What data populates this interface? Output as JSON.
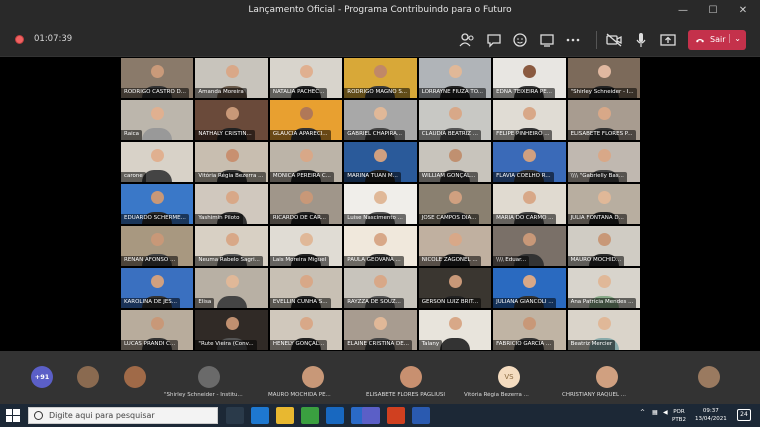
{
  "window": {
    "title": "Lançamento Oficial - Programa Contribuindo para o Futuro",
    "minimize_glyph": "—",
    "maximize_glyph": "☐",
    "close_glyph": "✕"
  },
  "toolbar": {
    "timer": "01:07:39",
    "leave_label": "Sair",
    "icons": [
      "people-icon",
      "chat-icon",
      "reactions-icon",
      "share-tray-icon",
      "more-options-icon",
      "camera-off-icon",
      "microphone-icon",
      "share-screen-icon",
      "phone-icon"
    ]
  },
  "participants": [
    {
      "name": "RODRIGO CASTRO D...",
      "bg": "#8a7a6a",
      "skin": "#c99a7a",
      "shirt": "#333"
    },
    {
      "name": "Amanda Moreira",
      "bg": "#c8c4bc",
      "skin": "#d9a888",
      "shirt": "#6a5a4a"
    },
    {
      "name": "NATALIA PACHEC...",
      "bg": "#d8d4cc",
      "skin": "#e0b090",
      "shirt": "#222"
    },
    {
      "name": "RODRIGO MAGNO S...",
      "bg": "#d8a838",
      "skin": "#c08868",
      "shirt": "#3a3a3a"
    },
    {
      "name": "LORRAYNE FIUZA TO...",
      "bg": "#b0b4b8",
      "skin": "#e0b898",
      "shirt": "#222"
    },
    {
      "name": "EDNA TEIXEIRA PE...",
      "bg": "#e8e6e2",
      "skin": "#8a5a40",
      "shirt": "#333"
    },
    {
      "name": "\"Shirley Schneider - I...",
      "bg": "#7c6a5a",
      "skin": "#e0b8a0",
      "shirt": "#222"
    },
    {
      "name": "Raica",
      "bg": "#bcb6ac",
      "skin": "#e0b090",
      "shirt": "#999"
    },
    {
      "name": "NATHALY CRISTIN...",
      "bg": "#6a4a3a",
      "skin": "#c89878",
      "shirt": "#222"
    },
    {
      "name": "GLAUCIA APARECI...",
      "bg": "#e8a030",
      "skin": "#b07858",
      "shirt": "#333"
    },
    {
      "name": "GABRIEL CHAPIRA...",
      "bg": "#a8a8a8",
      "skin": "#e0b898",
      "shirt": "#444"
    },
    {
      "name": "CLAUDIA BEATRIZ ...",
      "bg": "#c8c8c4",
      "skin": "#d8a888",
      "shirt": "#555"
    },
    {
      "name": "FELIPE PINHEIRO ...",
      "bg": "#e0dcd4",
      "skin": "#d8a888",
      "shirt": "#333"
    },
    {
      "name": "ELISABETE FLORES P...",
      "bg": "#a89c90",
      "skin": "#d8a888",
      "shirt": "#333"
    },
    {
      "name": "carone",
      "bg": "#d8d2c8",
      "skin": "#e0b090",
      "shirt": "#444"
    },
    {
      "name": "Vitória Régia Bezerra ...",
      "bg": "#c8beb0",
      "skin": "#c89070",
      "shirt": "#333"
    },
    {
      "name": "MONICA PEREIRA C...",
      "bg": "#bcb4a8",
      "skin": "#d8a888",
      "shirt": "#222"
    },
    {
      "name": "MARINA TUAN M...",
      "bg": "#2a5a9a",
      "skin": "#d0a080",
      "shirt": "#222"
    },
    {
      "name": "WILLIAM GONÇAL...",
      "bg": "#c8c4bc",
      "skin": "#c09070",
      "shirt": "#333"
    },
    {
      "name": "FLAVIA COELHO R...",
      "bg": "#3a6ab8",
      "skin": "#d0a080",
      "shirt": "#333"
    },
    {
      "name": "\\\\\\\\ \"Gabrielly Bas...",
      "bg": "#c0b8b0",
      "skin": "#d8a888",
      "shirt": "#444"
    },
    {
      "name": "EDUARDO SCHERME...",
      "bg": "#3a78c8",
      "skin": "#c89878",
      "shirt": "#2a2a2a"
    },
    {
      "name": "Yashimin Piloto",
      "bg": "#d0c8be",
      "skin": "#d8a888",
      "shirt": "#333"
    },
    {
      "name": "RICARDO DE CAR...",
      "bg": "#a0968a",
      "skin": "#c89878",
      "shirt": "#222"
    },
    {
      "name": "Luise Nascimento ...",
      "bg": "#f0eeea",
      "skin": "#e0b898",
      "shirt": "#555"
    },
    {
      "name": "JOSE CAMPOS DIA...",
      "bg": "#8a8070",
      "skin": "#d0a080",
      "shirt": "#333"
    },
    {
      "name": "MARIA DO CARMO ...",
      "bg": "#e0dad0",
      "skin": "#d8a888",
      "shirt": "#444"
    },
    {
      "name": "JULIA FONTANA D...",
      "bg": "#b8aea0",
      "skin": "#e0b898",
      "shirt": "#222"
    },
    {
      "name": "RENAN AFONSO ...",
      "bg": "#a89880",
      "skin": "#c89878",
      "shirt": "#444"
    },
    {
      "name": "Neuma Rabelo Sagri...",
      "bg": "#d8d0c4",
      "skin": "#d8a888",
      "shirt": "#555"
    },
    {
      "name": "Lais Moreira Miguel",
      "bg": "#e0dcd4",
      "skin": "#e0b898",
      "shirt": "#222"
    },
    {
      "name": "PAULA GEOVANA ...",
      "bg": "#f0e8dc",
      "skin": "#d8a888",
      "shirt": "#333"
    },
    {
      "name": "NICOLE ZAGONEL ...",
      "bg": "#c0b0a0",
      "skin": "#d8a888",
      "shirt": "#222"
    },
    {
      "name": "\\\\\\\\ Eduar...",
      "bg": "#7a7068",
      "skin": "#c89878",
      "shirt": "#333"
    },
    {
      "name": "MAURO MOCHID...",
      "bg": "#d0ccc4",
      "skin": "#c89878",
      "shirt": "#2a2a2a"
    },
    {
      "name": "KAROLINA DE JES...",
      "bg": "#3a70c0",
      "skin": "#d0a080",
      "shirt": "#333"
    },
    {
      "name": "Elisa",
      "bg": "#b8b0a4",
      "skin": "#e0b898",
      "shirt": "#444"
    },
    {
      "name": "EVELLIN CUNHA S...",
      "bg": "#c8c0b4",
      "skin": "#d8a888",
      "shirt": "#222"
    },
    {
      "name": "RAYZZA DE SOUZ...",
      "bg": "#c8c4bc",
      "skin": "#d8a888",
      "shirt": "#555"
    },
    {
      "name": "GERSON LUIZ BRIT...",
      "bg": "#3a3630",
      "skin": "#c89878",
      "shirt": "#222"
    },
    {
      "name": "JULIANA GIANCOLI ...",
      "bg": "#2a6ac0",
      "skin": "#d8a888",
      "shirt": "#333"
    },
    {
      "name": "Ana Patrícia Mendes ...",
      "bg": "#d8d4cc",
      "skin": "#e0b898",
      "shirt": "#8a8"
    },
    {
      "name": "LUCAS PRANDI C...",
      "bg": "#b8ac9c",
      "skin": "#c89878",
      "shirt": "#333"
    },
    {
      "name": "\"Rute Vieira (Conv...",
      "bg": "#302a26",
      "skin": "#c09070",
      "shirt": "#555"
    },
    {
      "name": "HENELY GONÇAL...",
      "bg": "#d0c8bc",
      "skin": "#d8a888",
      "shirt": "#222"
    },
    {
      "name": "ELAINE CRISTINA DE...",
      "bg": "#a89c90",
      "skin": "#e0b898",
      "shirt": "#444"
    },
    {
      "name": "Talany",
      "bg": "#e8e4dc",
      "skin": "#d8a888",
      "shirt": "#333"
    },
    {
      "name": "FABRICIO GARCIA ...",
      "bg": "#c0b4a4",
      "skin": "#c89878",
      "shirt": "#333"
    },
    {
      "name": "Beatriz Mercier",
      "bg": "#dad4ca",
      "skin": "#e0b898",
      "shirt": "#8aa"
    }
  ],
  "bottom_bar": {
    "more_count": "+91",
    "people": [
      {
        "name": "\"Shirley Schneider - Institu...",
        "initials": "",
        "avatar": "#6a6a6a"
      },
      {
        "name": "MAURO MOCHIDA PE...",
        "initials": "",
        "avatar": "#c89878"
      },
      {
        "name": "ELISABETE FLORES PAGLIUSI",
        "initials": "",
        "avatar": "#c89070"
      },
      {
        "name": "Vitória Régia Bezerra ...",
        "initials": "VS",
        "avatar": "#f4dcc0"
      },
      {
        "name": "CHRISTIANY RAQUEL ...",
        "initials": "",
        "avatar": "#d0a080"
      }
    ]
  },
  "taskbar": {
    "search_placeholder": "Digite aqui para pesquisar",
    "lang_top": "POR",
    "lang_bottom": "PTB2",
    "time": "09:37",
    "date": "13/04/2021",
    "notifications": "24"
  },
  "colors": {
    "leave_button": "#c4314b",
    "more_badge": "#5b5fc7",
    "recording": "#f06262"
  }
}
